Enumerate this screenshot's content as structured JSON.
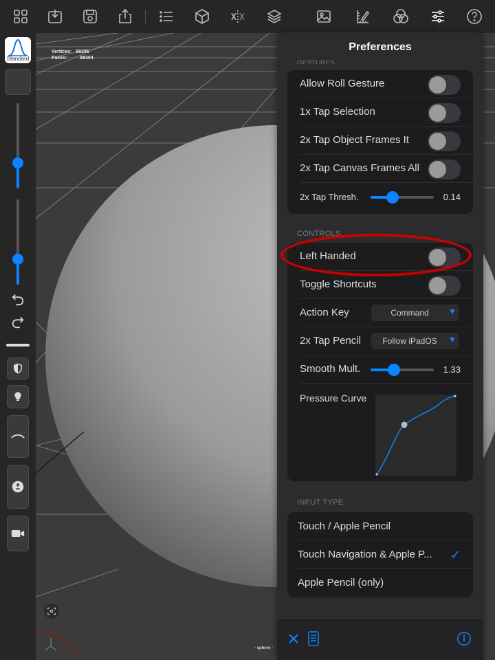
{
  "panel": {
    "title": "Preferences",
    "cut_header": "GESTURES"
  },
  "viewport": {
    "stats": {
      "vertices_label": "Vertices:",
      "vertices_value": "98306",
      "faces_label": "Faces:",
      "faces_value": "98304"
    },
    "object_label": "- sphere -"
  },
  "leftbar": {
    "material_label": "Standard",
    "slider1_level": 0.3,
    "slider2_level": 0.3
  },
  "gestures": {
    "rows": [
      {
        "label": "Allow Roll Gesture",
        "on": false
      },
      {
        "label": "1x Tap Selection",
        "on": false
      },
      {
        "label": "2x Tap Object Frames It",
        "on": false
      },
      {
        "label": "2x Tap Canvas Frames All",
        "on": false
      }
    ],
    "thresh_label": "2x Tap Thresh.",
    "thresh_value": "0.14",
    "thresh_level": 0.35
  },
  "controls": {
    "header": "CONTROLS",
    "left_handed": "Left Handed",
    "toggle_shortcuts": "Toggle Shortcuts",
    "action_key_label": "Action Key",
    "action_key_value": "Command",
    "tap_pencil_label": "2x Tap Pencil",
    "tap_pencil_value": "Follow iPadOS",
    "smooth_label": "Smooth Mult.",
    "smooth_value": "1.33",
    "smooth_level": 0.37,
    "pressure_label": "Pressure Curve"
  },
  "input_type": {
    "header": "INPUT TYPE",
    "options": [
      {
        "label": "Touch / Apple Pencil",
        "selected": false
      },
      {
        "label": "Touch Navigation & Apple P...",
        "selected": true
      },
      {
        "label": "Apple Pencil (only)",
        "selected": false
      }
    ],
    "check_glyph": "✓"
  },
  "icons": {
    "top": [
      "grid-icon",
      "import-icon",
      "save-icon",
      "share-icon",
      "list-icon",
      "cube-icon",
      "symmetry-icon",
      "layers-icon",
      "image-icon",
      "ruler-icon",
      "color-circles-icon",
      "sliders-icon",
      "help-icon"
    ],
    "accent": "#0a84ff"
  }
}
